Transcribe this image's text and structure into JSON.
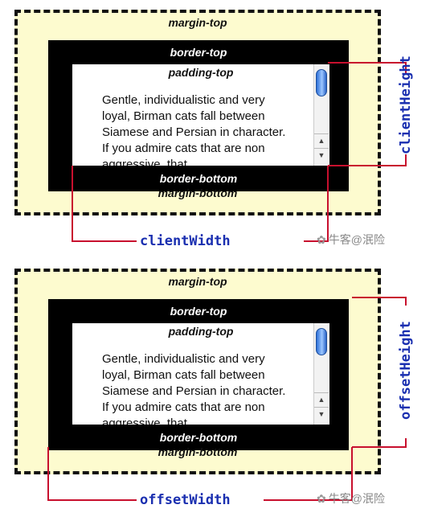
{
  "labels": {
    "margin_top": "margin-top",
    "border_top": "border-top",
    "padding_top": "padding-top",
    "border_bottom": "border-bottom",
    "margin_bottom": "margin-bottom"
  },
  "paragraph": "Gentle, individualistic and very loyal, Birman cats fall between Siamese and Persian in character. If you admire cats that are non aggressive, that",
  "scroll_icons": {
    "up": "▲",
    "down": "▼"
  },
  "diagram1": {
    "width_label": "clientWidth",
    "height_label": "clientHeight"
  },
  "diagram2": {
    "width_label": "offsetWidth",
    "height_label": "offsetHeight"
  },
  "watermark": {
    "icon": "paw-icon",
    "text": "牛客@泯险"
  },
  "colors": {
    "margin_fill": "#fdfbcf",
    "measure_line": "#c8102e",
    "measure_text": "#1a2fb0"
  }
}
